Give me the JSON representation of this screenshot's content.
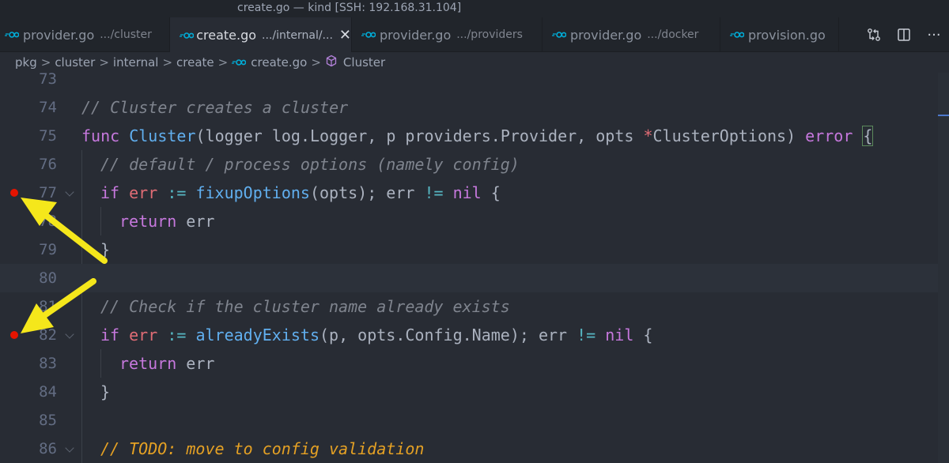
{
  "window": {
    "title": "create.go — kind [SSH: 192.168.31.104]"
  },
  "tabs": [
    {
      "name": "provider.go",
      "path": ".../cluster",
      "active": false
    },
    {
      "name": "create.go",
      "path": ".../internal/...",
      "active": true,
      "close": "✕"
    },
    {
      "name": "provider.go",
      "path": ".../providers",
      "active": false
    },
    {
      "name": "provider.go",
      "path": ".../docker",
      "active": false
    },
    {
      "name": "provision.go",
      "path": "",
      "active": false
    }
  ],
  "tab_actions": {
    "compare_icon": "git-compare-icon",
    "split_icon": "split-editor-icon",
    "more": "···"
  },
  "breadcrumb": [
    "pkg",
    "cluster",
    "internal",
    "create",
    "create.go",
    "Cluster"
  ],
  "breadcrumb_sep": ">",
  "code_lines": [
    {
      "num": "73",
      "breakpoint": false
    },
    {
      "num": "74",
      "breakpoint": false
    },
    {
      "num": "75",
      "breakpoint": false
    },
    {
      "num": "76",
      "breakpoint": false
    },
    {
      "num": "77",
      "breakpoint": true,
      "fold": true
    },
    {
      "num": "78",
      "breakpoint": false
    },
    {
      "num": "79",
      "breakpoint": false
    },
    {
      "num": "80",
      "breakpoint": false,
      "current": true
    },
    {
      "num": "81",
      "breakpoint": false
    },
    {
      "num": "82",
      "breakpoint": true,
      "fold": true
    },
    {
      "num": "83",
      "breakpoint": false
    },
    {
      "num": "84",
      "breakpoint": false
    },
    {
      "num": "85",
      "breakpoint": false
    },
    {
      "num": "86",
      "breakpoint": false,
      "fold": true
    }
  ],
  "code": {
    "l74_comment": "// Cluster creates a cluster",
    "l75_func": "func",
    "l75_name": "Cluster",
    "l75_params": "(logger log.Logger, p providers.Provider, opts ",
    "l75_ptr": "*",
    "l75_type": "ClusterOptions) ",
    "l75_error": "error",
    "l75_brace": "{",
    "l76_comment": "// default / process options (namely config)",
    "l77_if": "if",
    "l77_err": "err",
    "l77_assign": ":=",
    "l77_fn": "fixupOptions",
    "l77_args": "(opts); err ",
    "l77_ne": "!=",
    "l77_nil": "nil",
    "l77_brace": " {",
    "l78_return": "return",
    "l78_err": " err",
    "l79_brace": "}",
    "l81_comment": "// Check if the cluster name already exists",
    "l82_if": "if",
    "l82_err": "err",
    "l82_assign": ":=",
    "l82_fn": "alreadyExists",
    "l82_args": "(p, opts.Config.Name); err ",
    "l82_ne": "!=",
    "l82_nil": "nil",
    "l82_brace": " {",
    "l83_return": "return",
    "l83_err": " err",
    "l84_brace": "}",
    "l86_todo": "// TODO: move to config validation"
  },
  "colors": {
    "background": "#282c34",
    "breakpoint": "#e51400",
    "annotation_arrow": "#f5e71b"
  }
}
